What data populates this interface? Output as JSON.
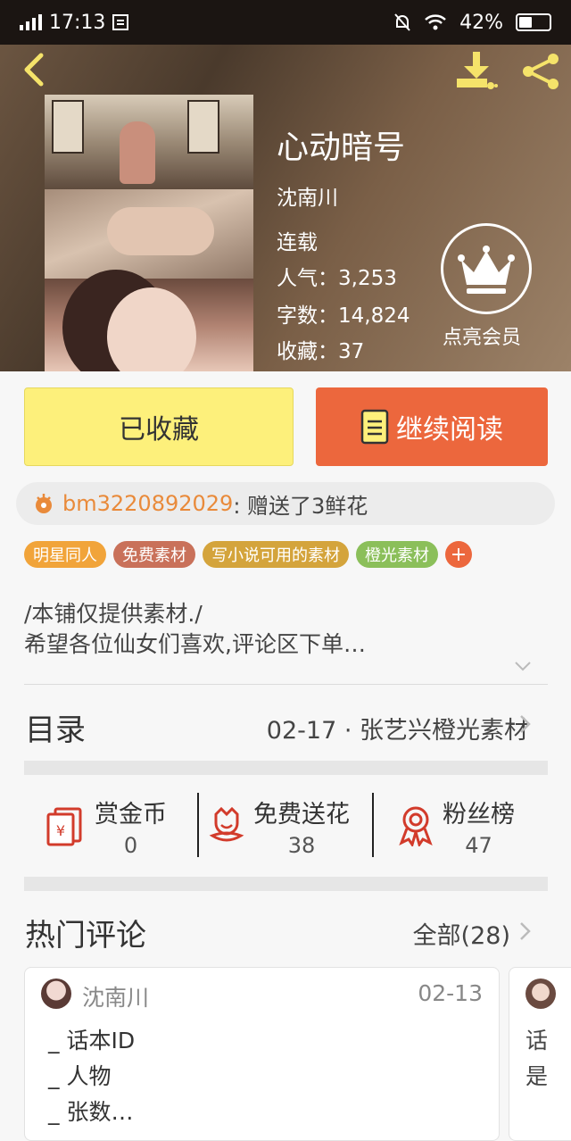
{
  "status_bar": {
    "time": "17:13",
    "battery": "42%"
  },
  "book": {
    "title": "心动暗号",
    "author": "沈南川",
    "status": "连载",
    "popularity_label": "人气：",
    "popularity": "3,253",
    "words_label": "字数：",
    "words": "14,824",
    "favorites_label": "收藏：",
    "favorites": "37"
  },
  "vip": {
    "label": "点亮会员"
  },
  "actions": {
    "collected_label": "已收藏",
    "continue_label": "继续阅读"
  },
  "gift": {
    "user": "bm3220892029",
    "message": ": 赠送了3鲜花"
  },
  "tags": [
    {
      "label": "明星同人",
      "color": "#f1a43a"
    },
    {
      "label": "免费素材",
      "color": "#c9715a"
    },
    {
      "label": "写小说可用的素材",
      "color": "#d4a43c"
    },
    {
      "label": "橙光素材",
      "color": "#8bbf5a"
    }
  ],
  "description": {
    "line1": "/本铺仅提供素材./",
    "line2": "希望各位仙女们喜欢,评论区下单…"
  },
  "toc": {
    "label": "目录",
    "latest": "02-17 · 张艺兴橙光素材"
  },
  "stats": [
    {
      "name": "赏金币",
      "value": "0",
      "icon": "red-envelope-icon"
    },
    {
      "name": "免费送花",
      "value": "38",
      "icon": "flower-icon"
    },
    {
      "name": "粉丝榜",
      "value": "47",
      "icon": "medal-icon"
    }
  ],
  "comments": {
    "title": "热门评论",
    "all_label": "全部(28)",
    "items": [
      {
        "user": "沈南川",
        "date": "02-13",
        "lines": [
          "_ 话本ID",
          "_ 人物",
          "_ 张数…"
        ]
      },
      {
        "lines": [
          "话",
          "是"
        ]
      }
    ]
  },
  "colors": {
    "accent_orange": "#ec673d",
    "collect_yellow": "#fdf07b",
    "username_orange": "#e98a3a"
  }
}
